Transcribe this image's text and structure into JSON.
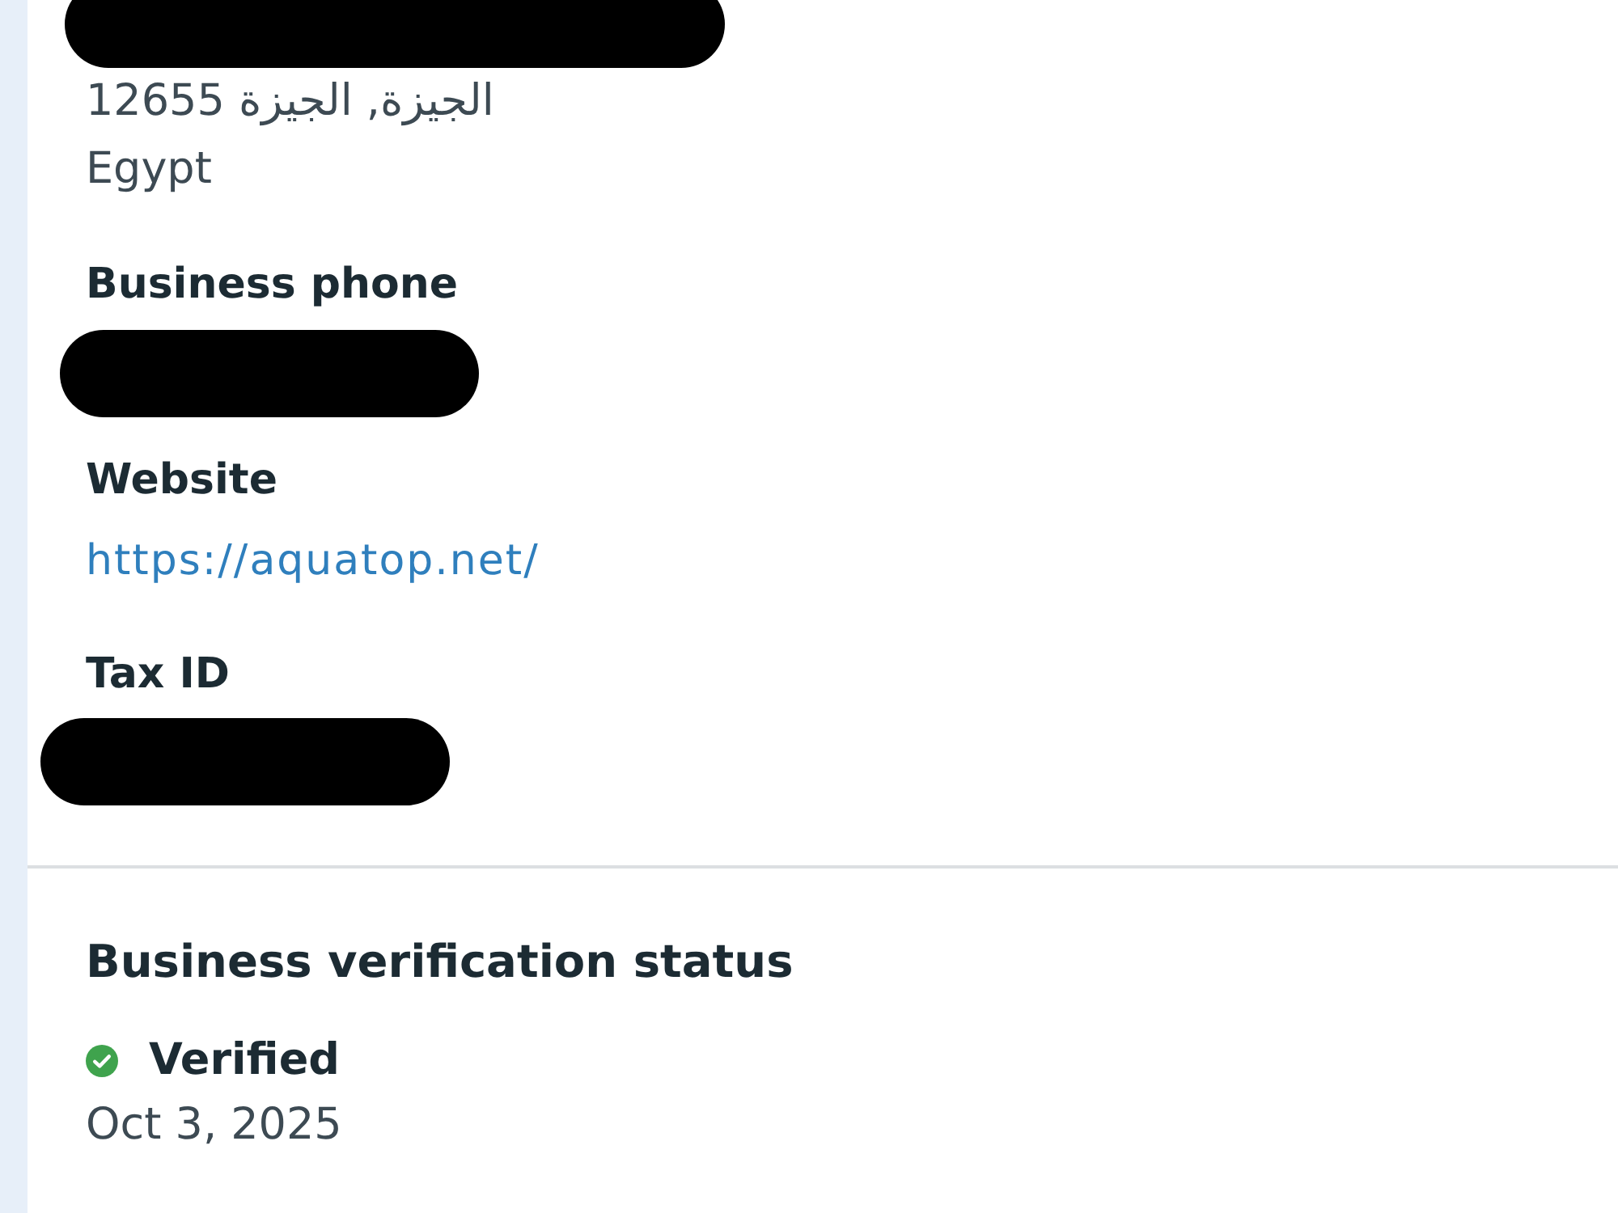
{
  "address": {
    "lines": [
      {
        "kind": "redacted"
      },
      {
        "kind": "text",
        "text": "الجيزة, الجيزة 12655"
      },
      {
        "kind": "text",
        "text": "Egypt"
      }
    ]
  },
  "fields": [
    {
      "label": "Business phone",
      "kind": "redacted"
    },
    {
      "label": "Website",
      "kind": "link",
      "value": "https://aquatop.net/"
    },
    {
      "label": "Tax ID",
      "kind": "redacted"
    }
  ],
  "verification": {
    "title": "Business verification status",
    "status": {
      "label": "Verified",
      "verified": true
    },
    "date": "Oct 3, 2025"
  }
}
